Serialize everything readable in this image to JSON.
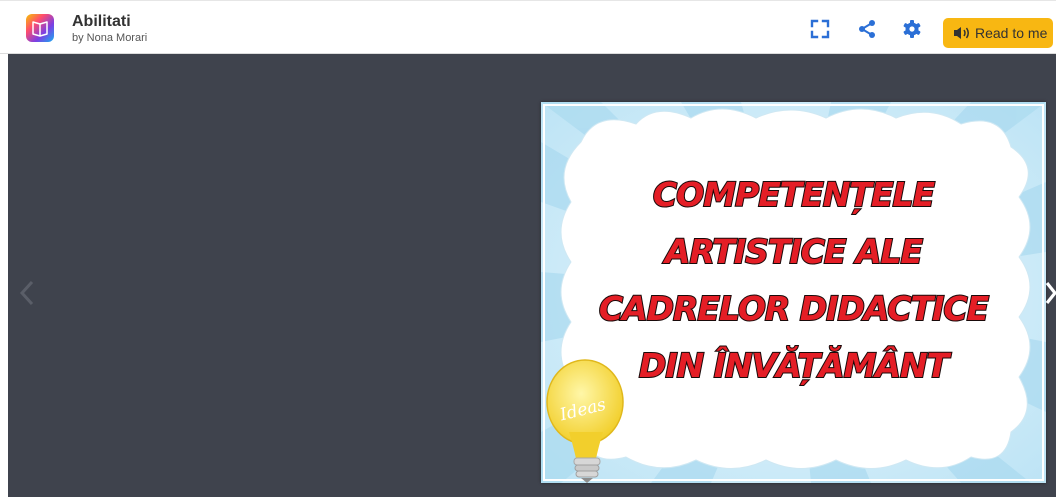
{
  "header": {
    "title": "Abilitati",
    "author": "by Nona Morari",
    "icons": [
      "fullscreen-icon",
      "share-icon",
      "settings-icon"
    ],
    "read_button_label": "Read to me"
  },
  "viewer": {
    "nav_prev_icon": "chevron-left-icon",
    "nav_next_icon": "chevron-right-icon",
    "cover": {
      "title_lines": [
        "COMPETENȚELE",
        "ARTISTICE ALE",
        "CADRELOR DIDACTICE",
        "DIN ÎNVĂȚĂMÂNT"
      ],
      "bulb_text": "Ideas"
    }
  },
  "colors": {
    "accent": "#f8b712",
    "icon_blue": "#2b6fd6",
    "viewer_bg": "#3f434d",
    "title_red": "#e41e26"
  }
}
